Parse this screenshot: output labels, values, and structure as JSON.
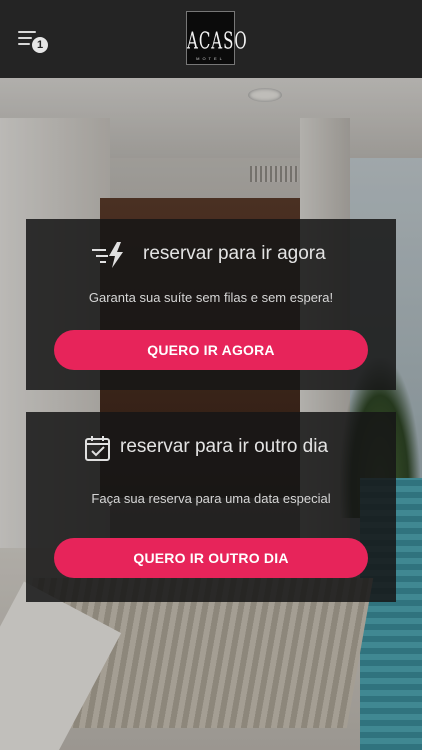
{
  "header": {
    "menu_badge": "1",
    "logo_text": "ACASO",
    "logo_sub": "MOTEL"
  },
  "card_now": {
    "icon": "speed-lightning-icon",
    "title": "reservar para ir agora",
    "subtitle": "Garanta sua suíte sem filas e sem espera!",
    "button": "QUERO IR AGORA"
  },
  "card_later": {
    "icon": "calendar-check-icon",
    "title": "reservar para ir outro dia",
    "subtitle": "Faça sua reserva para uma data especial",
    "button": "QUERO IR OUTRO DIA"
  },
  "colors": {
    "accent": "#e7245a",
    "topbar": "#242424",
    "card_bg": "rgba(22,22,22,0.86)"
  }
}
